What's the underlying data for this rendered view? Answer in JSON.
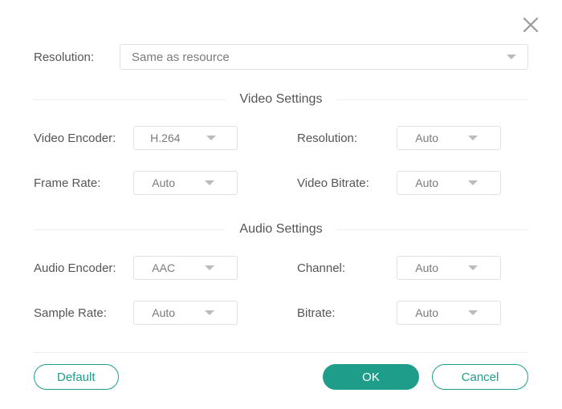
{
  "topResolution": {
    "label": "Resolution:",
    "value": "Same as resource"
  },
  "sections": {
    "video": {
      "title": "Video Settings",
      "fields": {
        "encoder": {
          "label": "Video Encoder:",
          "value": "H.264"
        },
        "resolution": {
          "label": "Resolution:",
          "value": "Auto"
        },
        "frameRate": {
          "label": "Frame Rate:",
          "value": "Auto"
        },
        "bitrate": {
          "label": "Video Bitrate:",
          "value": "Auto"
        }
      }
    },
    "audio": {
      "title": "Audio Settings",
      "fields": {
        "encoder": {
          "label": "Audio Encoder:",
          "value": "AAC"
        },
        "channel": {
          "label": "Channel:",
          "value": "Auto"
        },
        "sampleRate": {
          "label": "Sample Rate:",
          "value": "Auto"
        },
        "bitrate": {
          "label": "Bitrate:",
          "value": "Auto"
        }
      }
    }
  },
  "buttons": {
    "default": "Default",
    "ok": "OK",
    "cancel": "Cancel"
  }
}
